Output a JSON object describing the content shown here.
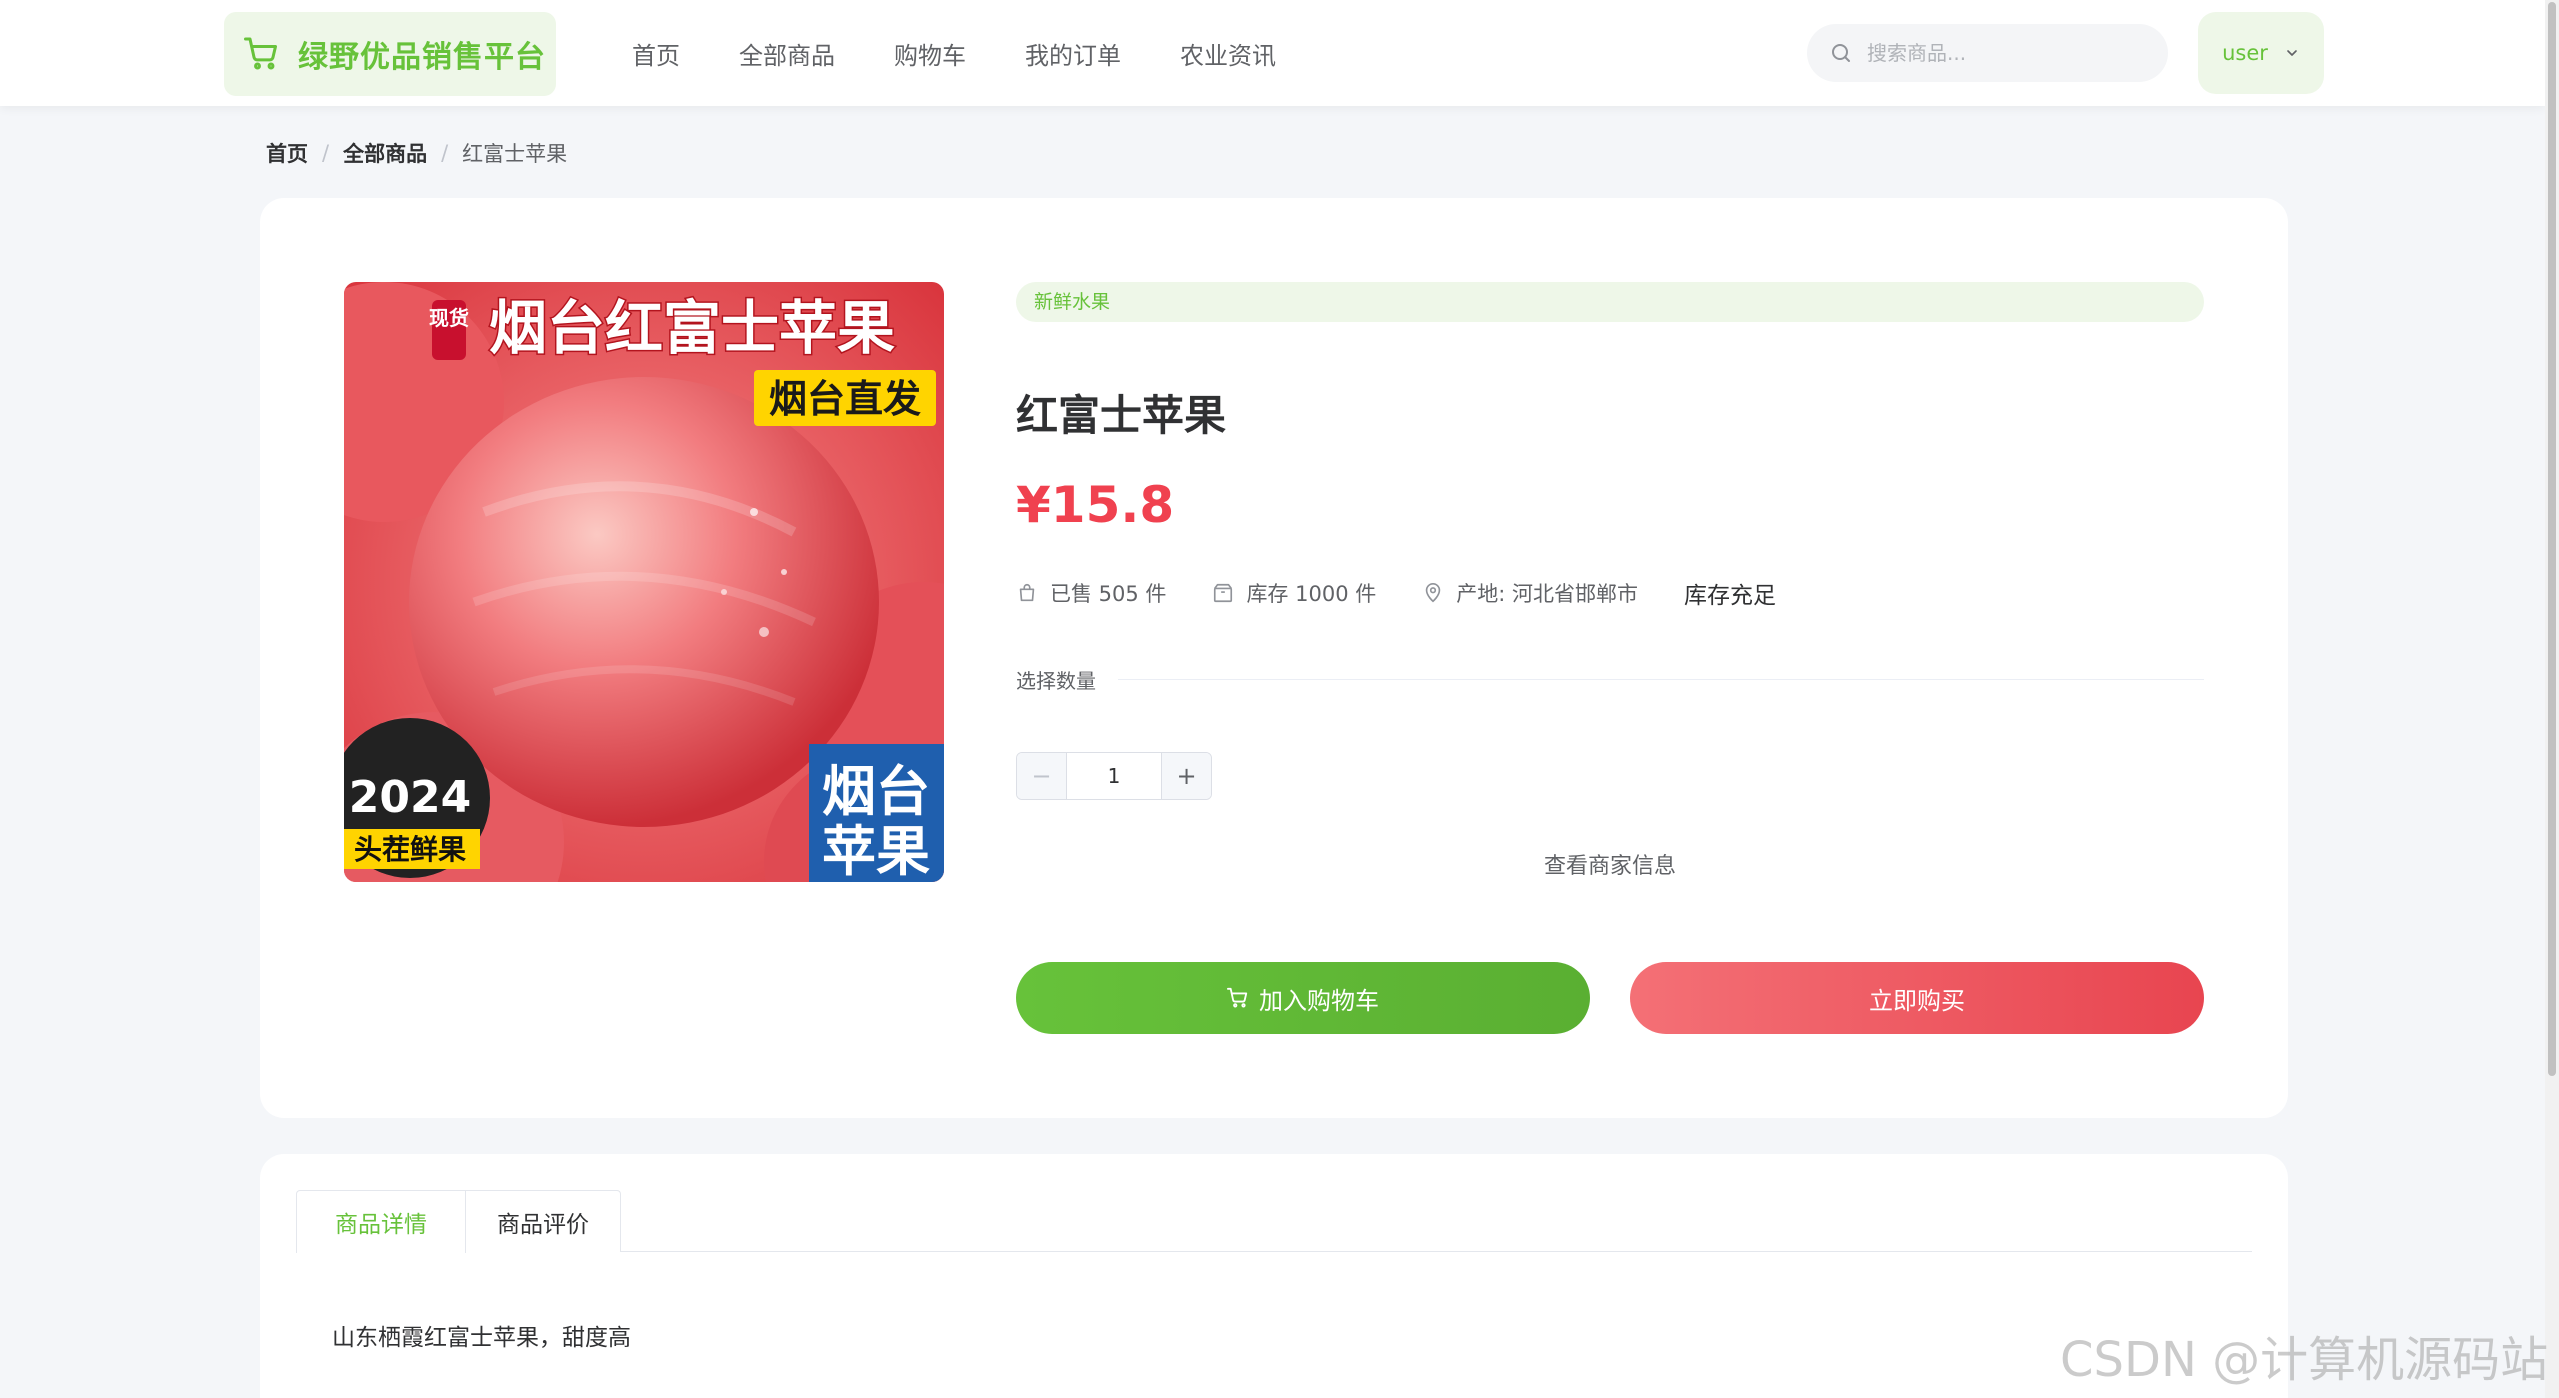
{
  "header": {
    "logo_text": "绿野优品销售平台",
    "nav": [
      "首页",
      "全部商品",
      "购物车",
      "我的订单",
      "农业资讯"
    ],
    "search_placeholder": "搜索商品...",
    "user_name": "user"
  },
  "breadcrumb": {
    "home": "首页",
    "separator1": "/",
    "all": "全部商品",
    "separator2": "/",
    "current": "红富士苹果"
  },
  "product": {
    "image_text": {
      "top_badge": "现货",
      "headline": "烟台红富士苹果",
      "ship_badge": "烟台直发",
      "year": "2024",
      "year_sub": "头茬鲜果",
      "corner_line1": "烟台",
      "corner_line2": "苹果"
    },
    "category": "新鲜水果",
    "title": "红富士苹果",
    "price": "¥15.8",
    "sold": "已售 505 件",
    "stock": "库存 1000 件",
    "origin": "产地: 河北省邯郸市",
    "stock_status": "库存充足",
    "quantity_label": "选择数量",
    "quantity_value": "1",
    "merchant_link": "查看商家信息",
    "add_to_cart": "加入购物车",
    "buy_now": "立即购买"
  },
  "details": {
    "tabs": [
      "商品详情",
      "商品评价"
    ],
    "active_tab": 0,
    "description": "山东栖霞红富士苹果，甜度高"
  },
  "watermark": "CSDN @计算机源码站",
  "colors": {
    "primary_green": "#67c23a",
    "price_red": "#f0414f",
    "buy_red": "#e84550",
    "page_bg": "#f4f6f9"
  },
  "icons": {
    "logo": "cart-icon",
    "search": "search-icon",
    "user_dropdown": "chevron-down-icon",
    "sold": "bag-icon",
    "stock": "box-icon",
    "origin": "location-icon",
    "cart_button": "cart-icon"
  }
}
